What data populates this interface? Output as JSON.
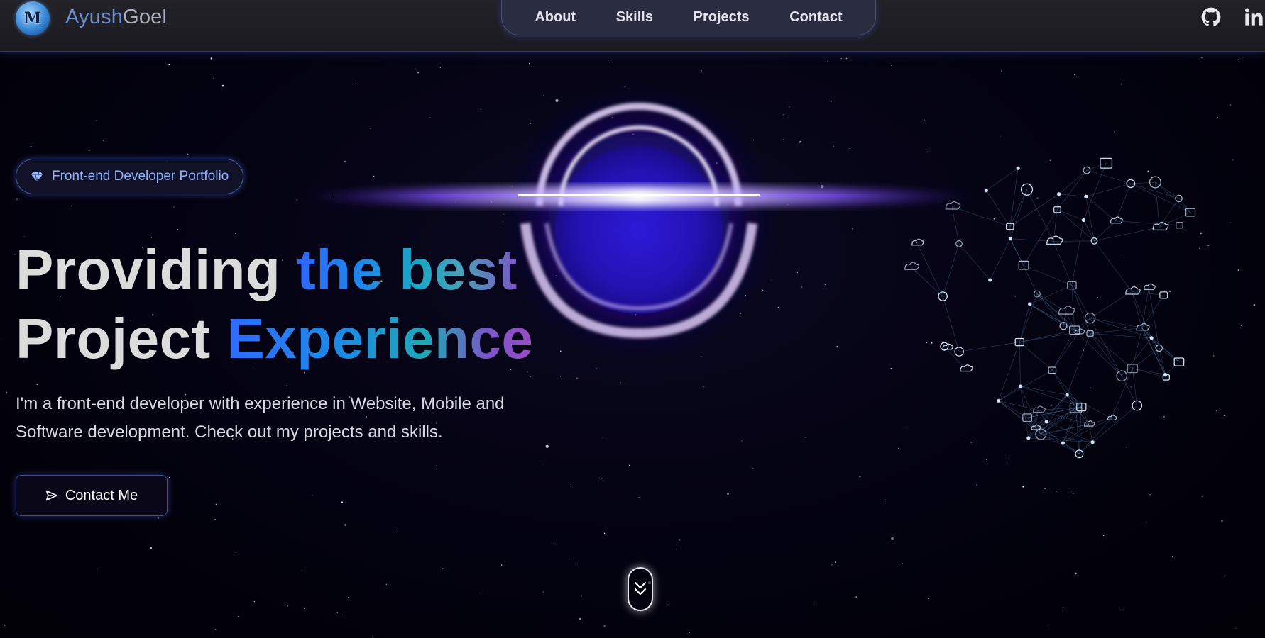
{
  "header": {
    "logo_glyph": "M",
    "brand_first": "Ayush",
    "brand_last": "Goel",
    "nav": [
      {
        "label": "About"
      },
      {
        "label": "Skills"
      },
      {
        "label": "Projects"
      },
      {
        "label": "Contact"
      }
    ],
    "social_icons": [
      "github-icon",
      "linkedin-icon"
    ]
  },
  "hero": {
    "tagline_icon": "diamond-icon",
    "tagline": "Front-end Developer Portfolio",
    "headline_line1_plain": "Providing ",
    "headline_line1_gradient": "the best",
    "headline_line2_plain": "Project ",
    "headline_line2_gradient": "Experience",
    "description": "I'm a front-end developer with experience in Website, Mobile and Software development. Check out my projects and skills.",
    "cta_label": "Contact Me",
    "cta_icon": "send-icon",
    "scroll_icon": "chevrons-down-icon"
  },
  "colors": {
    "background": "#020108",
    "header_bg": "#1f1f25",
    "nav_pill_bg": "#2a2c3f",
    "accent_blue": "#2e66ff",
    "accent_teal": "#1aa7c4",
    "accent_purple": "#7b55c4",
    "black_hole_glow": "#6a3cff"
  }
}
